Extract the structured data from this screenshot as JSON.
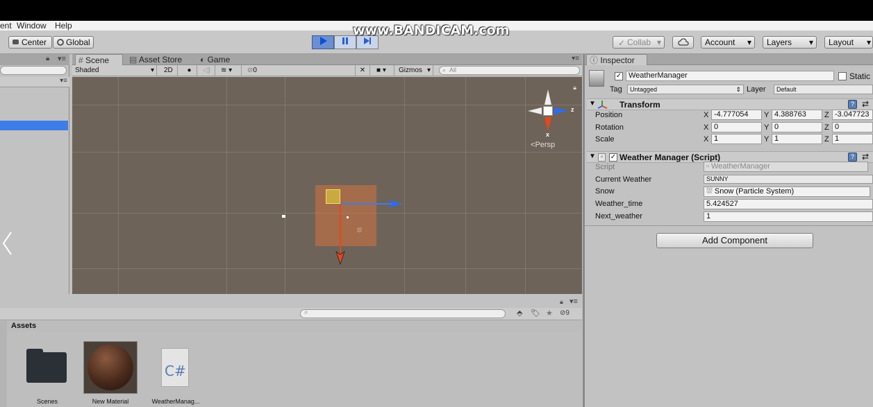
{
  "menu": {
    "items": [
      "ent",
      "Window",
      "Help"
    ]
  },
  "watermark": "www.BANDICAM.com",
  "toolbar": {
    "center_label": "Center",
    "global_label": "Global",
    "collab_label": "Collab",
    "account_label": "Account",
    "layers_label": "Layers",
    "layout_label": "Layout"
  },
  "scene_tabs": {
    "scene": "Scene",
    "asset_store": "Asset Store",
    "game": "Game"
  },
  "scene_toolbar": {
    "shading": "Shaded",
    "mode_2d": "2D",
    "fx_count": "0",
    "gizmos": "Gizmos",
    "search_placeholder": "All"
  },
  "gizmo": {
    "persp_label": "Persp",
    "axis_x": "x",
    "axis_z": "z"
  },
  "inspector": {
    "tab_label": "Inspector",
    "object_name": "WeatherManager",
    "static_label": "Static",
    "tag_label": "Tag",
    "tag_value": "Untagged",
    "layer_label": "Layer",
    "layer_value": "Default",
    "transform": {
      "title": "Transform",
      "position_label": "Position",
      "rotation_label": "Rotation",
      "scale_label": "Scale",
      "position": {
        "x": "-4.777054",
        "y": "4.388763",
        "z": "-3.047723"
      },
      "rotation": {
        "x": "0",
        "y": "0",
        "z": "0"
      },
      "scale": {
        "x": "1",
        "y": "1",
        "z": "1"
      },
      "axis_x": "X",
      "axis_y": "Y",
      "axis_z": "Z"
    },
    "script_component": {
      "title": "Weather Manager (Script)",
      "script_label": "Script",
      "script_value": "WeatherManager",
      "current_weather_label": "Current Weather",
      "current_weather_value": "SUNNY",
      "snow_label": "Snow",
      "snow_value": "Snow (Particle System)",
      "weather_time_label": "Weather_time",
      "weather_time_value": "5.424527",
      "next_weather_label": "Next_weather",
      "next_weather_value": "1"
    },
    "add_component_label": "Add Component"
  },
  "project": {
    "assets_title": "Assets",
    "hidden_count": "9",
    "items": [
      {
        "name": "Scenes",
        "icon": "folder-icon"
      },
      {
        "name": "New Material",
        "icon": "material-sphere-icon"
      },
      {
        "name": "WeatherManag...",
        "icon": "csharp-script-icon"
      }
    ],
    "csharp_glyph": "C#"
  },
  "colors": {
    "viewport": "#6e6358",
    "selection": "#3e7de7",
    "play_active": "#6b8fd1"
  }
}
